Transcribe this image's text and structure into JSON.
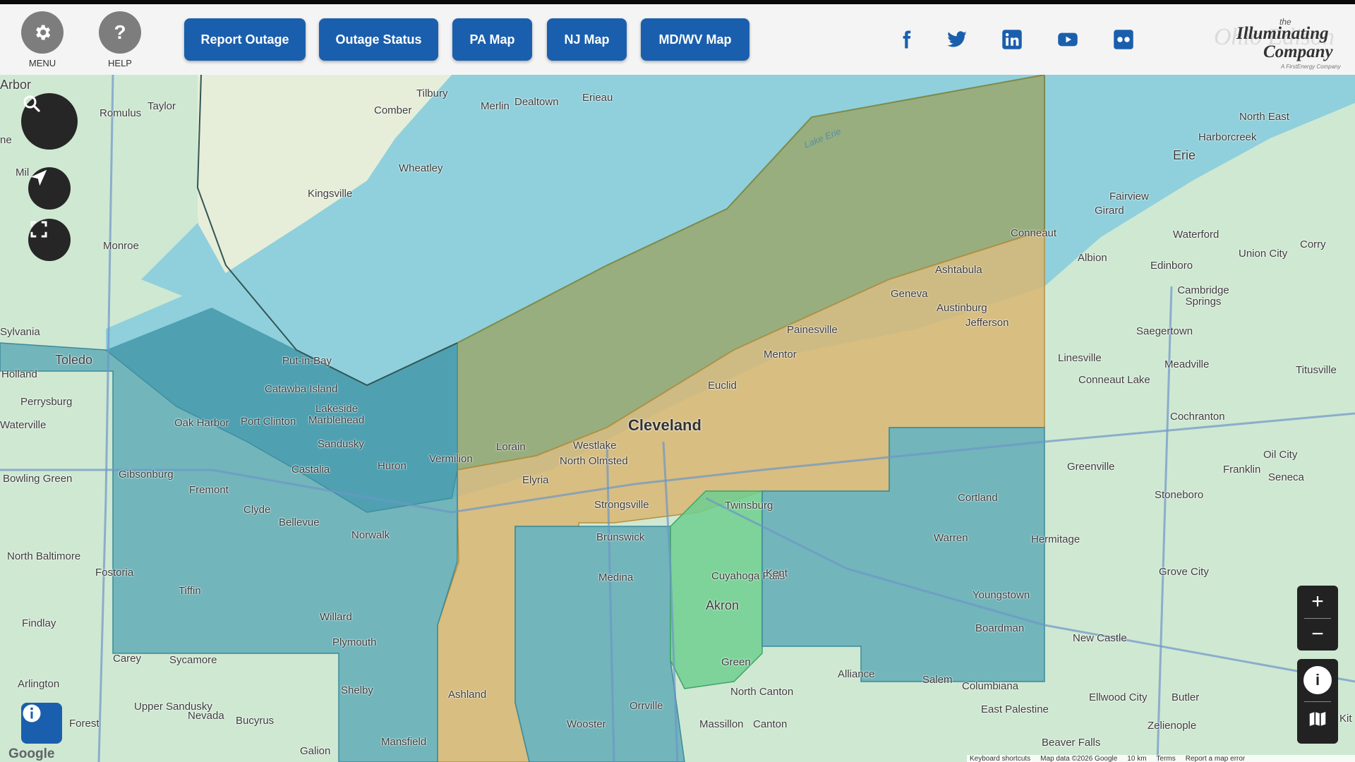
{
  "header": {
    "menu_label": "MENU",
    "help_label": "HELP",
    "nav_buttons": [
      "Report Outage",
      "Outage Status",
      "PA Map",
      "NJ Map",
      "MD/WV Map"
    ],
    "social_icons": [
      "facebook-icon",
      "twitter-icon",
      "linkedin-icon",
      "youtube-icon",
      "flickr-icon"
    ],
    "logo": {
      "ghost_text": "Ohio Edison",
      "the": "the",
      "name_line1": "Illuminating",
      "name_line2": "Company",
      "tagline": "A FirstEnergy Company"
    }
  },
  "map": {
    "water_label": "Lake Erie",
    "places": {
      "cleveland": "Cleveland",
      "toledo": "Toledo",
      "akron": "Akron",
      "erie": "Erie",
      "lorain": "Lorain",
      "elyria": "Elyria",
      "westlake": "Westlake",
      "north_olmsted": "North Olmsted",
      "strongsville": "Strongsville",
      "euclid": "Euclid",
      "mentor": "Mentor",
      "painesville": "Painesville",
      "geneva": "Geneva",
      "ashtabula": "Ashtabula",
      "austinburg": "Austinburg",
      "jefferson": "Jefferson",
      "conneaut": "Conneaut",
      "twinsburg": "Twinsburg",
      "cuyahoga_falls": "Cuyahoga Falls",
      "kent": "Kent",
      "green": "Green",
      "brunswick": "Brunswick",
      "medina": "Medina",
      "wooster": "Wooster",
      "orrville": "Orrville",
      "ashland": "Ashland",
      "mansfield": "Mansfield",
      "shelby": "Shelby",
      "plymouth": "Plymouth",
      "willard": "Willard",
      "norwalk": "Norwalk",
      "bellevue": "Bellevue",
      "clyde": "Clyde",
      "fremont": "Fremont",
      "sandusky": "Sandusky",
      "huron": "Huron",
      "vermilion": "Vermilion",
      "castalia": "Castalia",
      "put_in_bay": "Put-in-Bay",
      "catawba": "Catawba Island",
      "lakeside": "Lakeside",
      "marblehead": "Marblehead",
      "port_clinton": "Port Clinton",
      "oak_harbor": "Oak Harbor",
      "gibsonburg": "Gibsonburg",
      "perrysburg": "Perrysburg",
      "holland": "Holland",
      "sylvania": "Sylvania",
      "monroe": "Monroe",
      "ann_arbor": "Arbor",
      "taylor": "Taylor",
      "romulus": "Romulus",
      "tilbury": "Tilbury",
      "comber": "Comber",
      "merlin": "Merlin",
      "dealtown": "Dealtown",
      "erieau": "Erieau",
      "wheatley": "Wheatley",
      "kingsville": "Kingsville",
      "bowling_green": "Bowling Green",
      "waterville": "Waterville",
      "north_baltimore": "North Baltimore",
      "fostoria": "Fostoria",
      "tiffin": "Tiffin",
      "findlay": "Findlay",
      "carey": "Carey",
      "sycamore": "Sycamore",
      "arlington": "Arlington",
      "upper_sandusky": "Upper Sandusky",
      "nevada": "Nevada",
      "bucyrus": "Bucyrus",
      "forest": "Forest",
      "galion": "Galion",
      "cortland": "Cortland",
      "warren": "Warren",
      "youngstown": "Youngstown",
      "boardman": "Boardman",
      "salem": "Salem",
      "columbiana": "Columbiana",
      "alliance": "Alliance",
      "north_canton": "North Canton",
      "canton": "Canton",
      "massillon": "Massillon",
      "east_palestine": "East Palestine",
      "beaver_falls": "Beaver Falls",
      "new_castle": "New Castle",
      "ellwood_city": "Ellwood City",
      "zelienople": "Zelienople",
      "butler": "Butler",
      "grove_city": "Grove City",
      "hermitage": "Hermitage",
      "greenville": "Greenville",
      "stoneboro": "Stoneboro",
      "franklin": "Franklin",
      "oil_city": "Oil City",
      "seneca": "Seneca",
      "cochranton": "Cochranton",
      "titusville": "Titusville",
      "meadville": "Meadville",
      "conneaut_lake": "Conneaut Lake",
      "linesville": "Linesville",
      "saegertown": "Saegertown",
      "cambridge_springs": "Cambridge Springs",
      "edinboro": "Edinboro",
      "union_city": "Union City",
      "corry": "Corry",
      "waterford": "Waterford",
      "albion": "Albion",
      "girard": "Girard",
      "fairview": "Fairview",
      "harborcreek": "Harborcreek",
      "north_east": "North East",
      "kit": "Kit",
      "ne": "ne",
      "mil": "Mil"
    }
  },
  "attribution": {
    "shortcuts": "Keyboard shortcuts",
    "map_data": "Map data ©2026 Google",
    "scale": "10 km",
    "terms": "Terms",
    "report": "Report a map error"
  },
  "google_logo": "Google",
  "colors": {
    "header_bg": "#f4f4f4",
    "button_blue": "#1a5fad",
    "lake": "#8fd0dc",
    "land": "#c8e6c9",
    "zone_blue": "#5aa8b5",
    "zone_orange": "#d9b673",
    "zone_olive": "#9aa86f",
    "zone_green": "#6fcf8f"
  }
}
